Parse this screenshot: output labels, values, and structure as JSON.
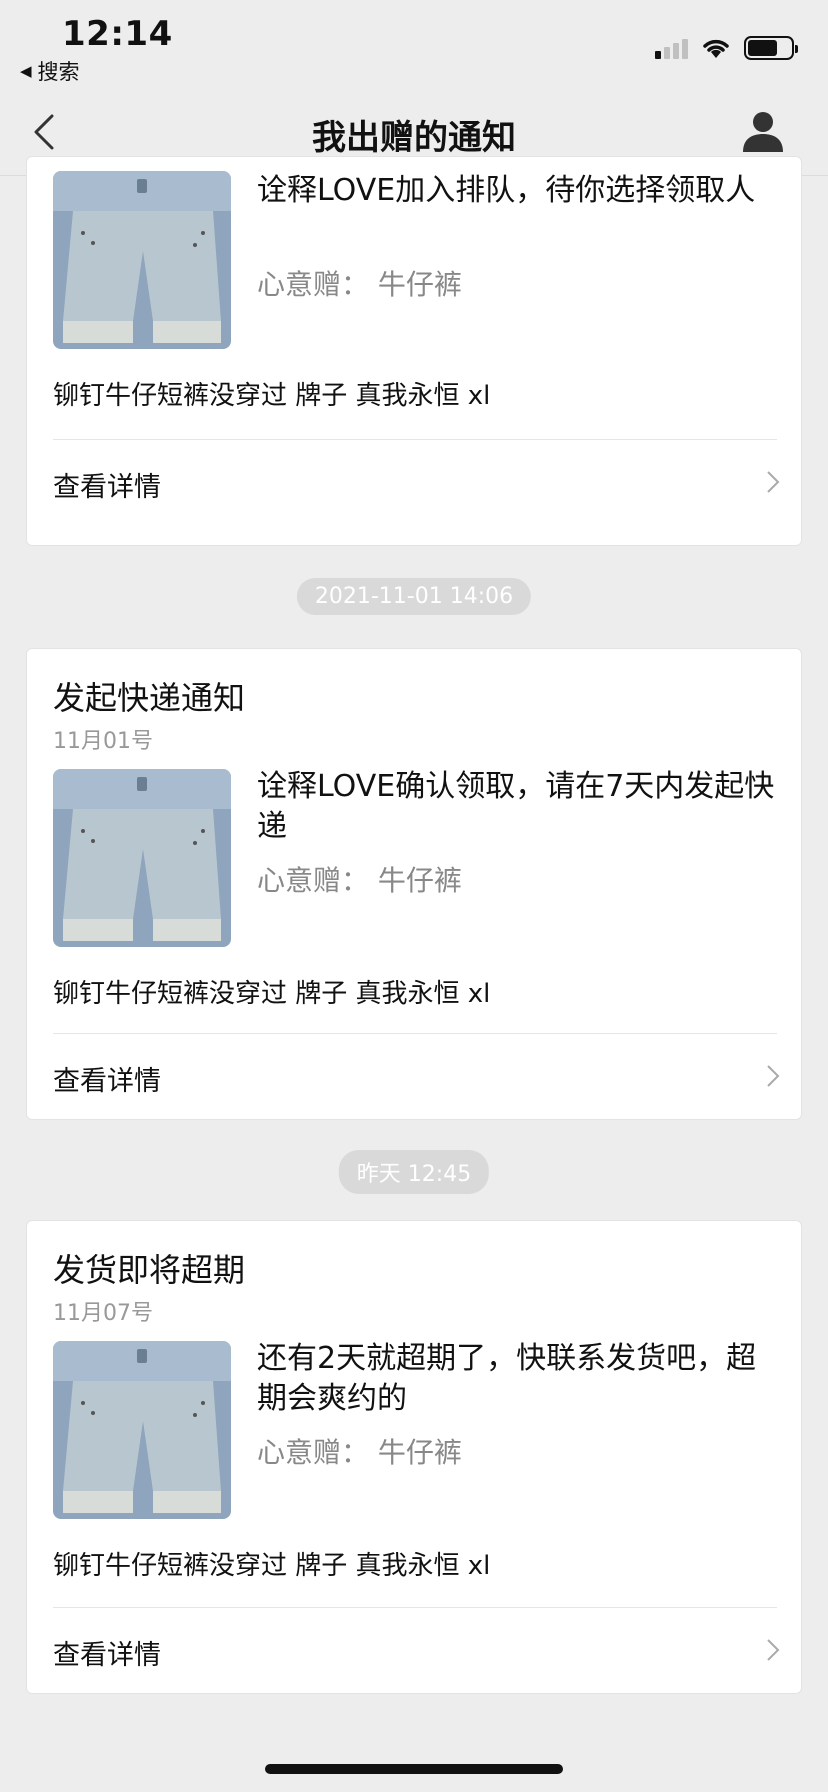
{
  "status_bar": {
    "time": "12:14",
    "back_app": "搜索"
  },
  "nav": {
    "title": "我出赠的通知"
  },
  "notifications": [
    {
      "title": "",
      "date": "",
      "message": "诠释LOVE加入排队，待你选择领取人",
      "gift": "心意赠：  牛仔裤",
      "description": "铆钉牛仔短裤没穿过 牌子 真我永恒 xl",
      "detail_label": "查看详情"
    },
    {
      "title": "发起快递通知",
      "date": "11月01号",
      "message": "诠释LOVE确认领取，请在7天内发起快递",
      "gift": "心意赠：  牛仔裤",
      "description": "铆钉牛仔短裤没穿过 牌子 真我永恒 xl",
      "detail_label": "查看详情"
    },
    {
      "title": "发货即将超期",
      "date": "11月07号",
      "message": "还有2天就超期了，快联系发货吧，超期会爽约的",
      "gift": "心意赠：  牛仔裤",
      "description": "铆钉牛仔短裤没穿过 牌子 真我永恒 xl",
      "detail_label": "查看详情"
    }
  ],
  "timestamps": [
    "2021-11-01 14:06",
    "昨天 12:45"
  ],
  "icons": {
    "back": "chevron-left-icon",
    "user": "user-icon",
    "detail": "chevron-right-icon",
    "thumbnail": "denim-shorts-image"
  },
  "colors": {
    "background": "#ededed",
    "card": "#ffffff",
    "muted_text": "#888888",
    "pill": "#d9d9d9"
  }
}
